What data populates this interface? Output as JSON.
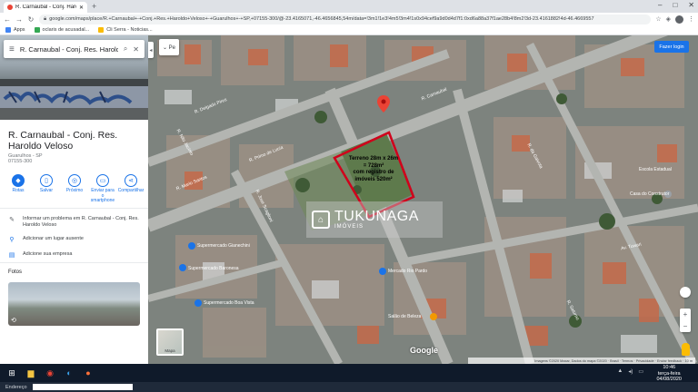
{
  "browser": {
    "tab_title": "R. Carnaubal - Conj. Haroldo",
    "new_tab": "+",
    "window_buttons": [
      "–",
      "□",
      "✕"
    ],
    "url": "google.com/maps/place/R.+Carnaubal+-+Conj.+Res.+Haroldo+Veloso+-+Guarulhos+-+SP,+07155-300/@-23.4165071,-46.4656845,54m/data=!3m1!1e3!4m5!3m4!1s0x94cef9a9d0d4d7f1:0xd6a88a37f1ae28b4!8m2!3d-23.4161882!4d-46.4669557",
    "bookmarks": [
      "Apps",
      "oclaris de acusadal...",
      "Cli Serra - Noticias..."
    ]
  },
  "search": {
    "query": "R. Carnaubal - Conj. Res. Haroldo"
  },
  "place": {
    "title": "R. Carnaubal - Conj. Res. Haroldo Veloso",
    "type": "Guarulhos - SP",
    "code": "07155-300",
    "actions": [
      {
        "label": "Rotas",
        "icon": "directions-icon"
      },
      {
        "label": "Salvar",
        "icon": "bookmark-icon"
      },
      {
        "label": "Próximo",
        "icon": "nearby-icon"
      },
      {
        "label": "Enviar para o smartphone",
        "icon": "send-phone-icon"
      },
      {
        "label": "Compartilhar",
        "icon": "share-icon"
      }
    ],
    "rows": [
      {
        "text": "Informar um problema em R. Carnaubal - Conj. Res. Haroldo Veloso",
        "icon": "pencil-icon"
      },
      {
        "text": "Adicionar um lugar ausente",
        "icon": "pin-plus-icon"
      },
      {
        "text": "Adicione sua empresa",
        "icon": "store-icon"
      }
    ],
    "photos_label": "Fotos"
  },
  "map": {
    "signin_label": "Fazer login",
    "search_area": "⌄ Pe",
    "annotation": [
      "Terreno 28m x 26m",
      "= 728m²",
      "com registro de",
      "imóveis 520m²"
    ],
    "watermark": "TUKUNAGA",
    "watermark_sub": "IMÓVEIS",
    "satellite_label": "Mapa",
    "google_logo": "Google",
    "attribution": "Imagens ©2020 Maxar, Dados do mapa ©2020 · Brasil · Termos · Privacidade · Enviar feedback · 10 m",
    "zoom_in": "+",
    "zoom_out": "−",
    "street_labels": [
      "R. Carnaubal",
      "R. Primo de Lucia",
      "R. Mario Santos",
      "R. Delgado Pires",
      "R. Nilo Jacinto",
      "R. Jose Scaglioni",
      "Supermercado Gianechini",
      "Supermercado Baronesa",
      "Supermercado Boa Vista",
      "Salão de Beleza",
      "Mercado Rio Pardo",
      "Av. Tuwari",
      "R. da Gaivota",
      "Casa do Construtor",
      "Escola Estadual",
      "R. Saturno"
    ]
  },
  "taskbar": {
    "time": "10:46",
    "day": "terça-feira",
    "date": "04/08/2020",
    "address_label": "Endereço"
  },
  "colors": {
    "accent": "#1a73e8",
    "annotation": "#d0021b",
    "pin": "#ea4335"
  }
}
